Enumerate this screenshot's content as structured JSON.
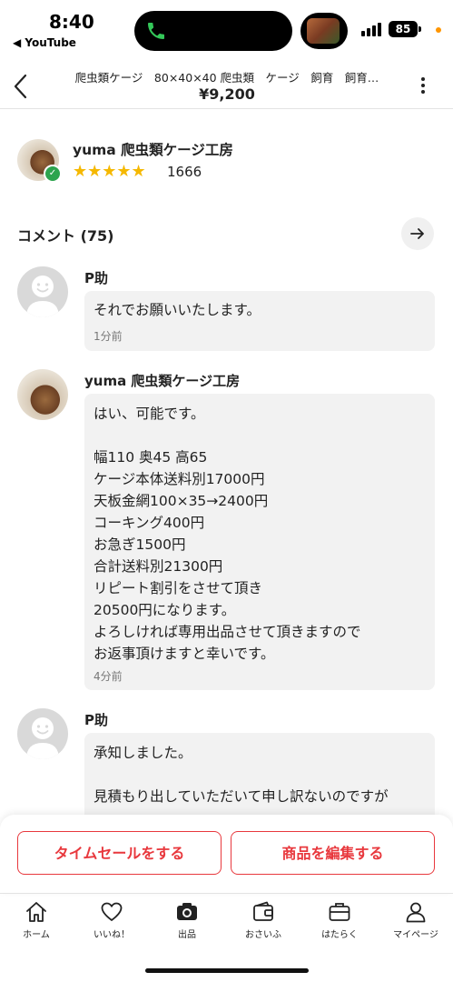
{
  "status": {
    "time": "8:40",
    "back_app": "◀ YouTube",
    "battery": "85"
  },
  "header": {
    "title": "爬虫類ケージ　80×40×40 爬虫類　ケージ　飼育　飼育…",
    "price": "¥9,200"
  },
  "seller": {
    "name": "yuma 爬虫類ケージ工房",
    "stars": "★★★★★",
    "rating_count": "1666"
  },
  "comments": {
    "title": "コメント (75)",
    "items": [
      {
        "name": "P助",
        "text": "それでお願いいたします。",
        "time": "1分前"
      },
      {
        "name": "yuma 爬虫類ケージ工房",
        "text": "はい、可能です。\n\n幅110 奥45 高65\nケージ本体送料別17000円\n天板金網100×35→2400円\nコーキング400円\nお急ぎ1500円\n合計送料別21300円\nリピート割引をさせて頂き\n20500円になります。\nよろしければ専用出品させて頂きますので\nお返事頂けますと幸いです。",
        "time": "4分前"
      },
      {
        "name": "P助",
        "text": "承知しました。\n\n見積もり出していただいて申し訳ないのですが",
        "time": ""
      }
    ]
  },
  "actions": {
    "timesale": "タイムセールをする",
    "edit": "商品を編集する"
  },
  "nav": [
    {
      "label": "ホーム",
      "icon": "home-icon"
    },
    {
      "label": "いいね！",
      "icon": "heart-icon"
    },
    {
      "label": "出品",
      "icon": "camera-icon"
    },
    {
      "label": "おさいふ",
      "icon": "wallet-icon"
    },
    {
      "label": "はたらく",
      "icon": "briefcase-icon"
    },
    {
      "label": "マイページ",
      "icon": "person-icon"
    }
  ],
  "colors": {
    "accent": "#e8383d",
    "star": "#f5b800",
    "verified": "#2da44e"
  }
}
